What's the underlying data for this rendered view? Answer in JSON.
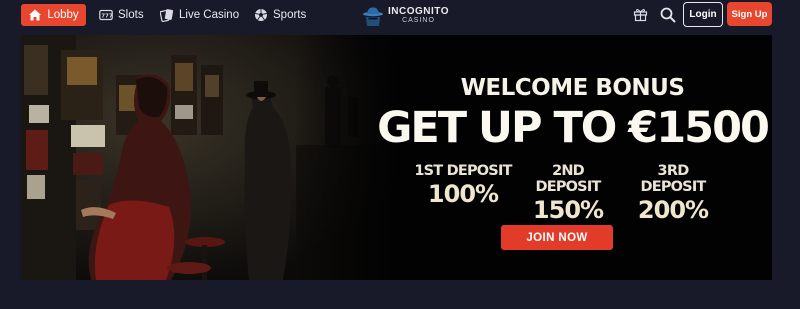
{
  "nav": {
    "lobby": "Lobby",
    "slots": "Slots",
    "live_casino": "Live Casino",
    "sports": "Sports",
    "logo_name": "INCOGNITO",
    "logo_sub": "CASINO",
    "login": "Login",
    "signup": "Sign Up"
  },
  "banner": {
    "welcome": "WELCOME BONUS",
    "headline": "GET UP TO €1500",
    "deposits": [
      {
        "label": "1ST DEPOSIT",
        "percent": "100%"
      },
      {
        "label": "2ND DEPOSIT",
        "percent": "150%"
      },
      {
        "label": "3RD DEPOSIT",
        "percent": "200%"
      }
    ],
    "cta": "JOIN NOW"
  },
  "colors": {
    "page_bg": "#181a29",
    "accent": "#e8462e",
    "banner_bg": "#020203",
    "gold_text": "#efe6cc"
  },
  "icons": {
    "lobby": "home-icon",
    "slots": "slot-machine-icon",
    "live_casino": "cards-icon",
    "sports": "soccer-ball-icon",
    "gift": "gift-icon",
    "search": "search-icon"
  }
}
